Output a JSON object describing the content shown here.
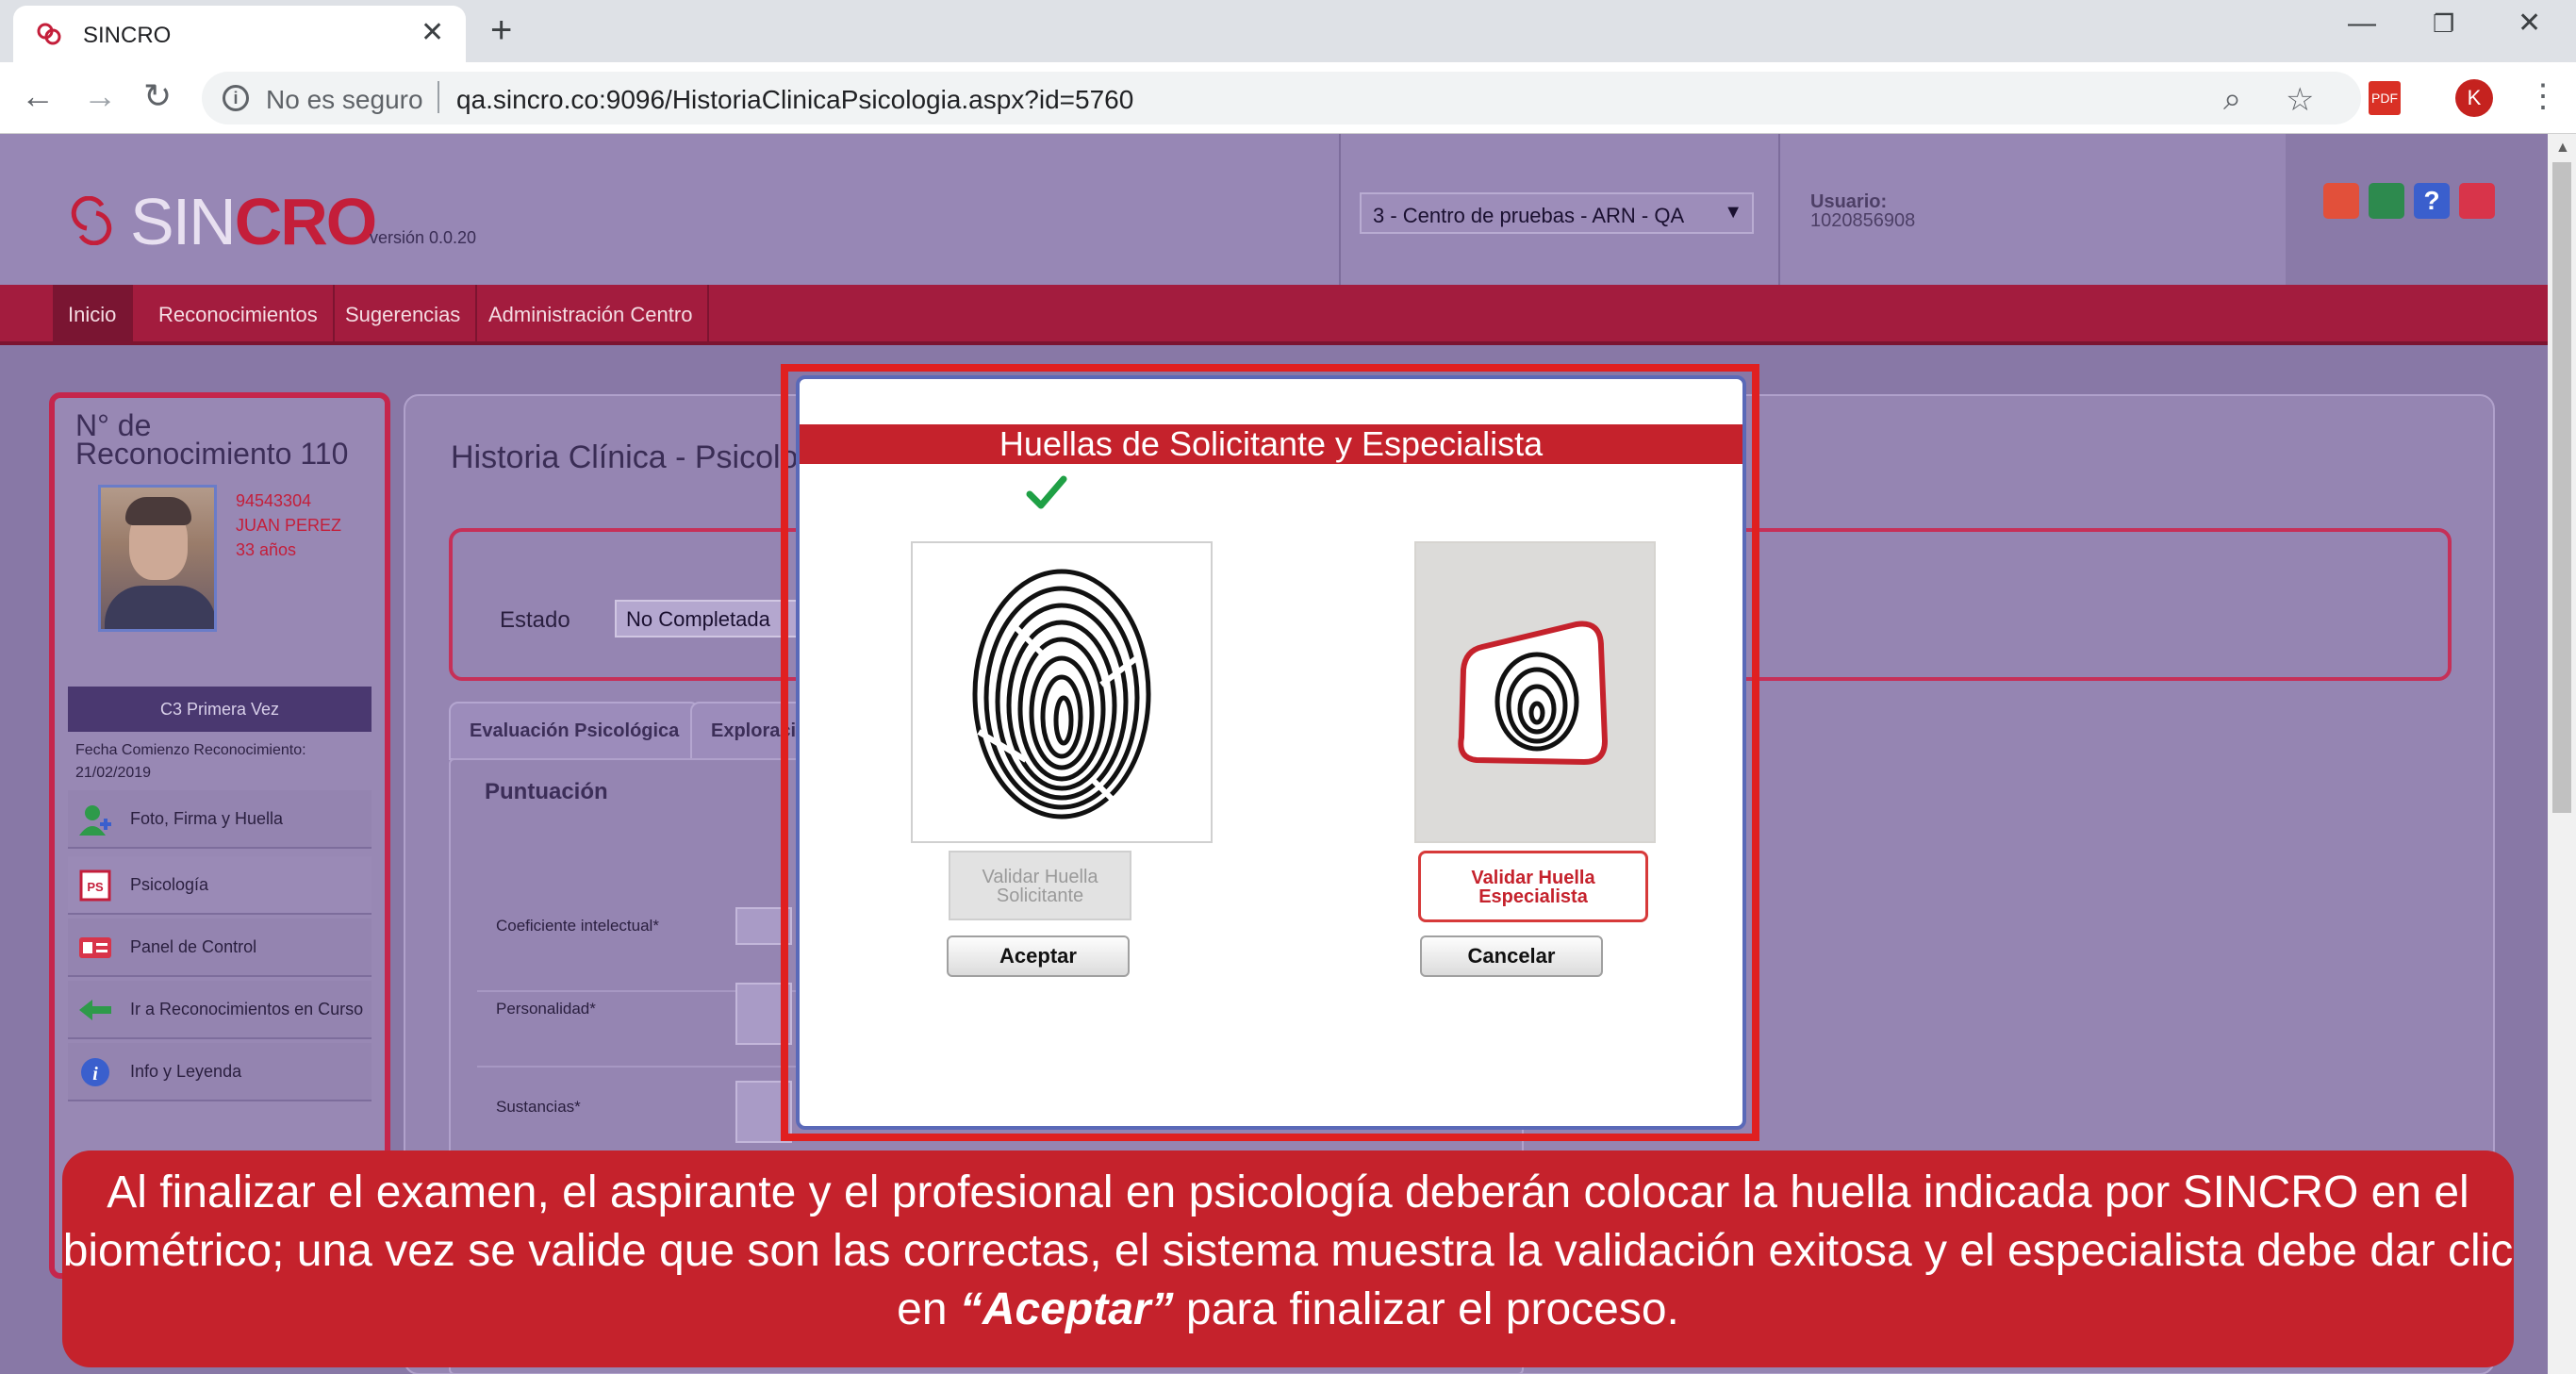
{
  "browser": {
    "tab_title": "SINCRO",
    "not_secure": "No es seguro",
    "url": "qa.sincro.co:9096/HistoriaClinicaPsicologia.aspx?id=5760",
    "profile_initial": "K"
  },
  "header": {
    "logo_sin": "SIN",
    "logo_cro": "CRO",
    "version": "versión 0.0.20",
    "center_select": "3 - Centro de pruebas - ARN - QA",
    "usuario_label": "Usuario:",
    "usuario_value": "1020856908"
  },
  "nav": {
    "items": [
      "Inicio",
      "Reconocimientos",
      "Sugerencias",
      "Administración Centro"
    ]
  },
  "sidebar": {
    "rec_title_line1": "N° de",
    "rec_title_line2": "Reconocimiento 110",
    "id": "94543304",
    "name": "JUAN PEREZ",
    "age": "33 años",
    "category": "C3 Primera Vez",
    "fecha_label": "Fecha Comienzo Reconocimiento:",
    "fecha_value": "21/02/2019",
    "links": [
      "Foto, Firma y Huella",
      "Psicología",
      "Panel de Control",
      "Ir a Reconocimientos en Curso",
      "Info y Leyenda"
    ]
  },
  "content": {
    "title": "Historia Clínica - Psicolog",
    "estado_label": "Estado",
    "estado_value": "No Completada",
    "tabs": [
      "Evaluación Psicológica",
      "Exploraci"
    ],
    "puntuacion": "Puntuación",
    "rows": [
      "Coeficiente intelectual*",
      "Personalidad*",
      "Sustancias*"
    ]
  },
  "modal": {
    "title": "Huellas de Solicitante y Especialista",
    "validar_solicitante_l1": "Validar Huella",
    "validar_solicitante_l2": "Solicitante",
    "validar_especialista_l1": "Validar Huella",
    "validar_especialista_l2": "Especialista",
    "aceptar": "Aceptar",
    "cancelar": "Cancelar"
  },
  "caption": {
    "text_before": "Al finalizar el examen, el aspirante y el profesional en psicología deberán colocar la huella indicada por SINCRO en el biométrico; una vez se valide que son las correctas, el sistema muestra la validación exitosa y el especialista debe dar clic en ",
    "emphasis": "“Aceptar”",
    "text_after": " para finalizar el proceso."
  },
  "colors": {
    "brand_red": "#c5222c",
    "nav_maroon": "#a31c3e",
    "overlay_purple": "#8878a6",
    "success_green": "#1fa045"
  }
}
